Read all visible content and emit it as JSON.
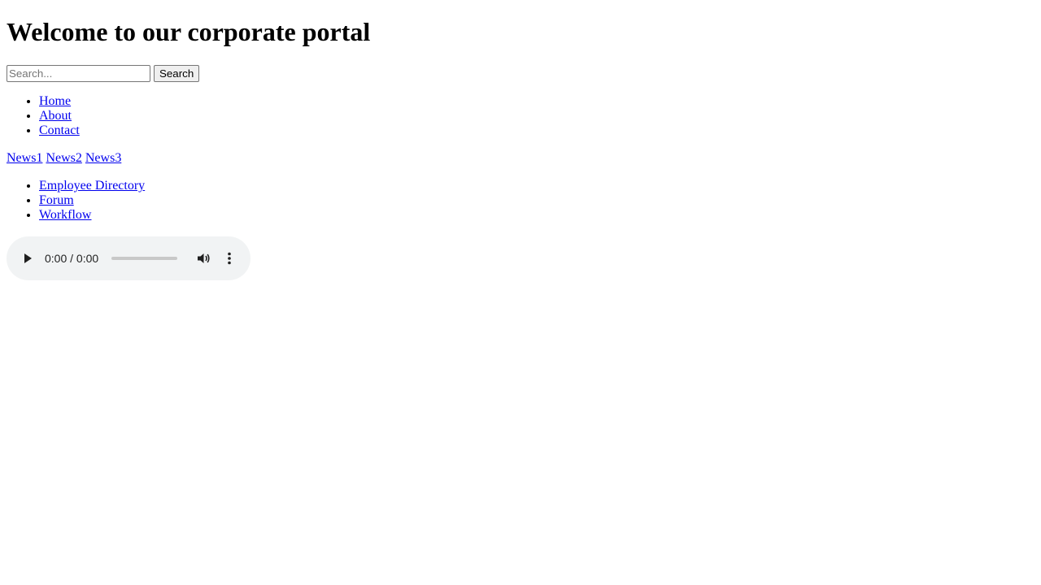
{
  "header": {
    "title": "Welcome to our corporate portal"
  },
  "search": {
    "placeholder": "Search...",
    "value": "",
    "button_label": "Search",
    "search_icon": "none"
  },
  "nav": {
    "items": [
      {
        "label": "Home"
      },
      {
        "label": "About"
      },
      {
        "label": "Contact"
      }
    ]
  },
  "news": {
    "items": [
      {
        "label": "News1"
      },
      {
        "label": "News2"
      },
      {
        "label": "News3"
      }
    ]
  },
  "tools": {
    "items": [
      {
        "label": "Employee Directory"
      },
      {
        "label": "Forum"
      },
      {
        "label": "Workflow"
      }
    ]
  },
  "audio": {
    "time_display": "0:00 / 0:00",
    "progress": 0,
    "icons": [
      "play-icon",
      "volume-icon",
      "more-options-icon"
    ]
  },
  "colors": {
    "link": "#0000ee",
    "player_background": "#f1f3f4",
    "button_background": "#efefef"
  }
}
